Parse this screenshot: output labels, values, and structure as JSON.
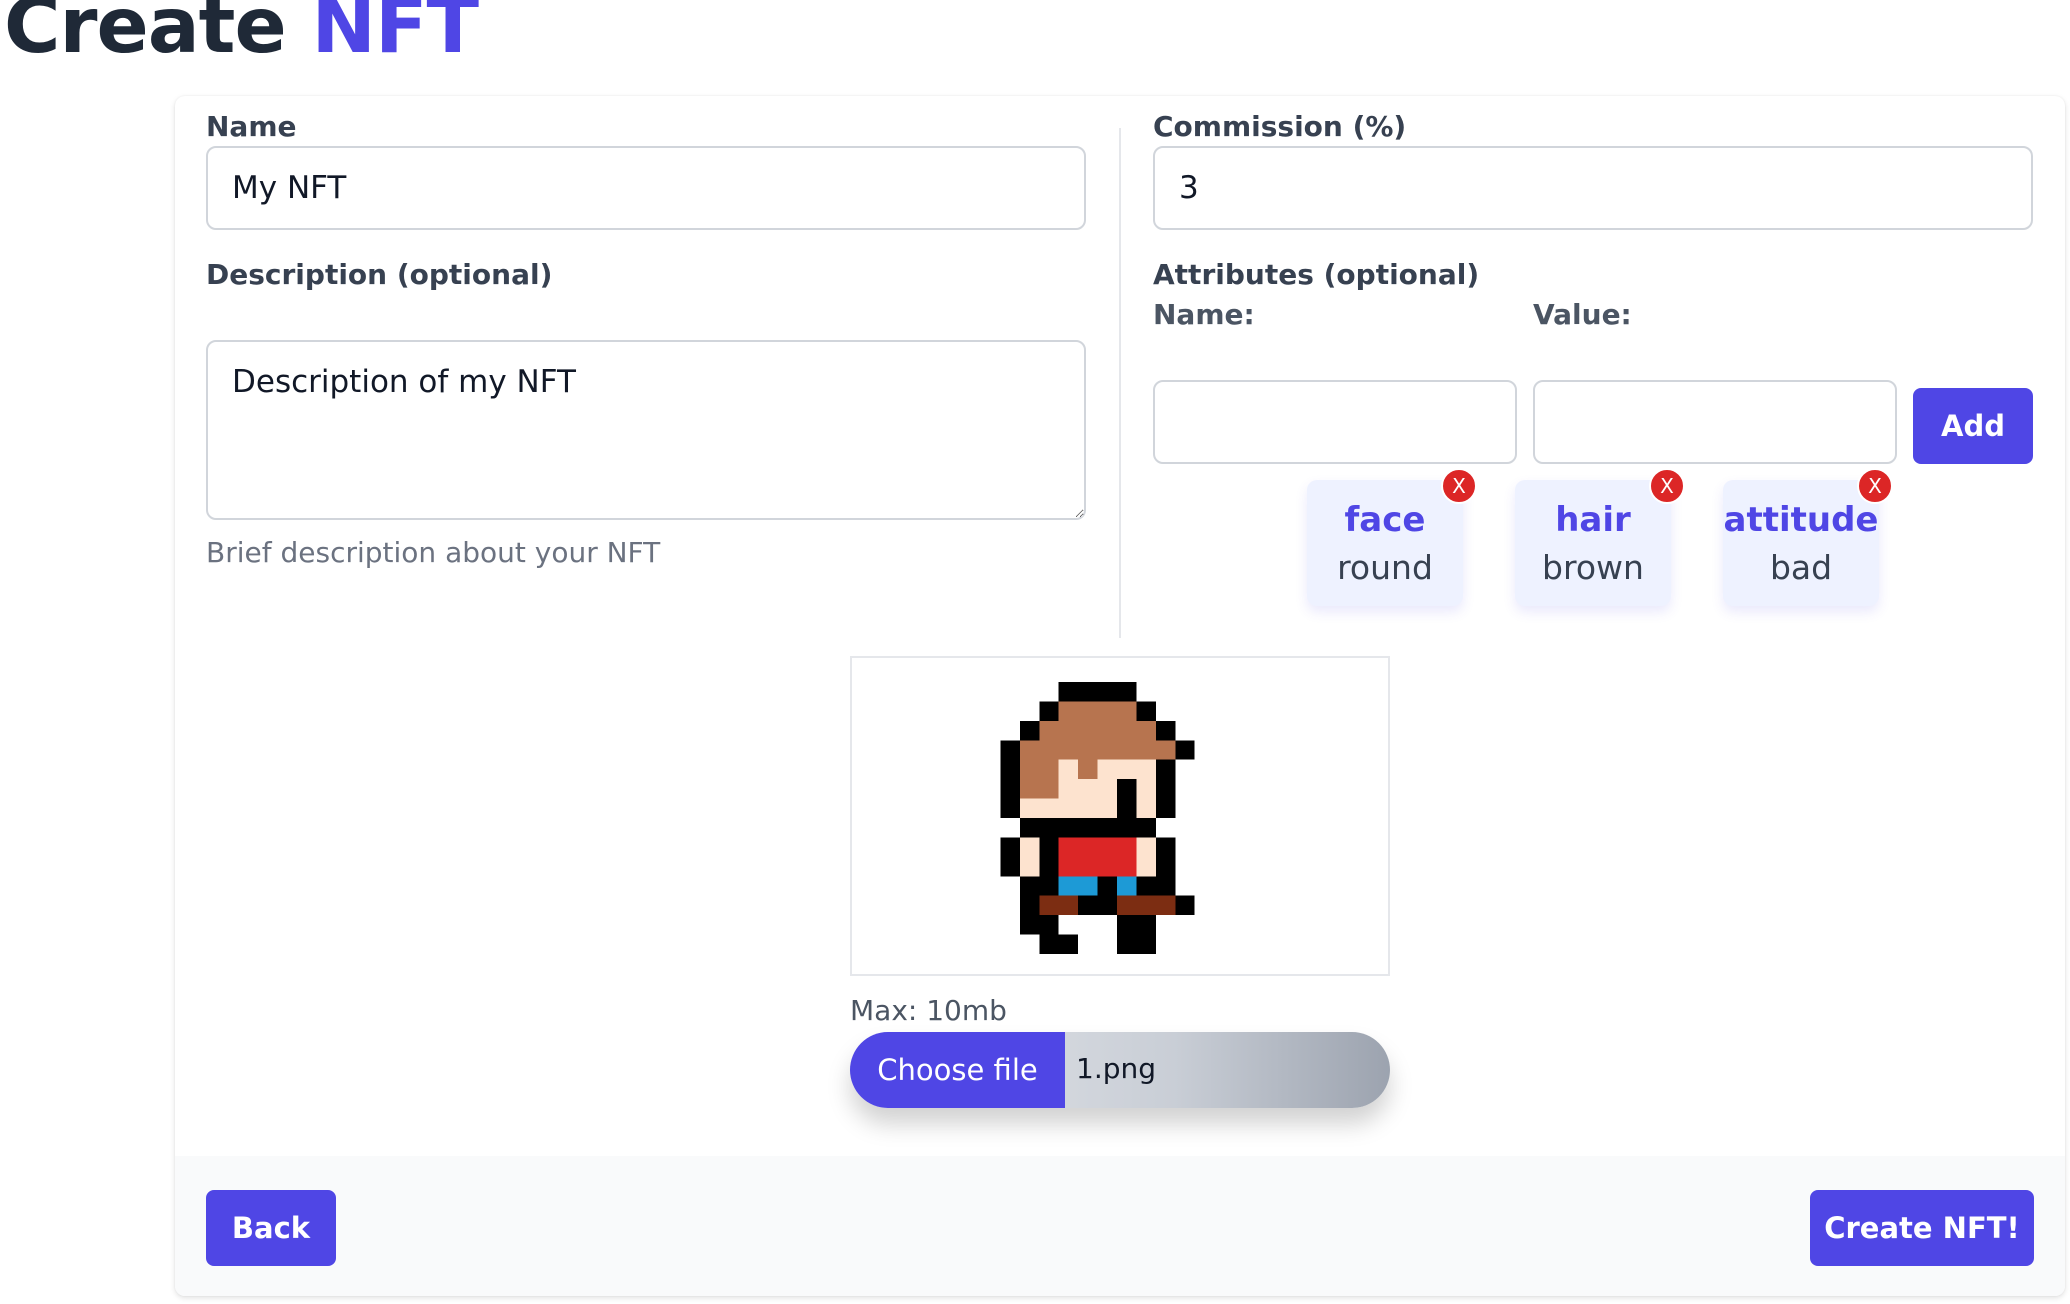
{
  "header": {
    "title_prefix": "Create",
    "title_accent": "NFT"
  },
  "form": {
    "name": {
      "label": "Name",
      "value": "My NFT"
    },
    "description": {
      "label": "Description (optional)",
      "value": "Description of my NFT",
      "help": "Brief description about your NFT"
    },
    "commission": {
      "label": "Commission (%)",
      "value": "3"
    },
    "attributes": {
      "label": "Attributes (optional)",
      "name_label": "Name:",
      "value_label": "Value:",
      "name_value": "",
      "value_value": "",
      "add_label": "Add",
      "items": [
        {
          "name": "face",
          "value": "round",
          "remove": "X"
        },
        {
          "name": "hair",
          "value": "brown",
          "remove": "X"
        },
        {
          "name": "attitude",
          "value": "bad",
          "remove": "X"
        }
      ]
    },
    "image": {
      "max_size": "Max: 10mb",
      "choose_label": "Choose file",
      "file_name": "1.png"
    }
  },
  "footer": {
    "back_label": "Back",
    "create_label": "Create NFT!"
  },
  "colors": {
    "accent": "#4f46e5",
    "remove": "#dc2626",
    "chip_bg": "#eef2ff",
    "footer_bg": "#f9fafb"
  }
}
